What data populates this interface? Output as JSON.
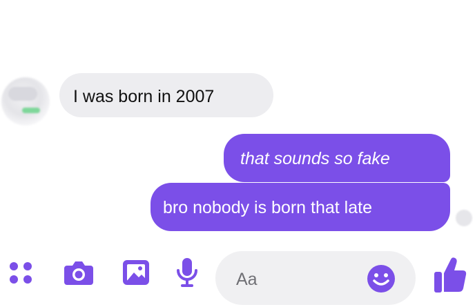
{
  "conversation": {
    "messages": [
      {
        "direction": "received",
        "text": "I was born in 2007"
      },
      {
        "direction": "sent",
        "text": "that sounds so fake"
      },
      {
        "direction": "sent",
        "text": "bro nobody is born that late"
      }
    ]
  },
  "composer": {
    "placeholder": "Aa",
    "icons": [
      "menu-dots-icon",
      "camera-icon",
      "image-icon",
      "microphone-icon",
      "emoji-icon",
      "thumbs-up-icon"
    ]
  },
  "colors": {
    "sent_bubble": "#7b4fe8",
    "received_bubble": "#ededf0",
    "accent": "#7b4fe8"
  }
}
